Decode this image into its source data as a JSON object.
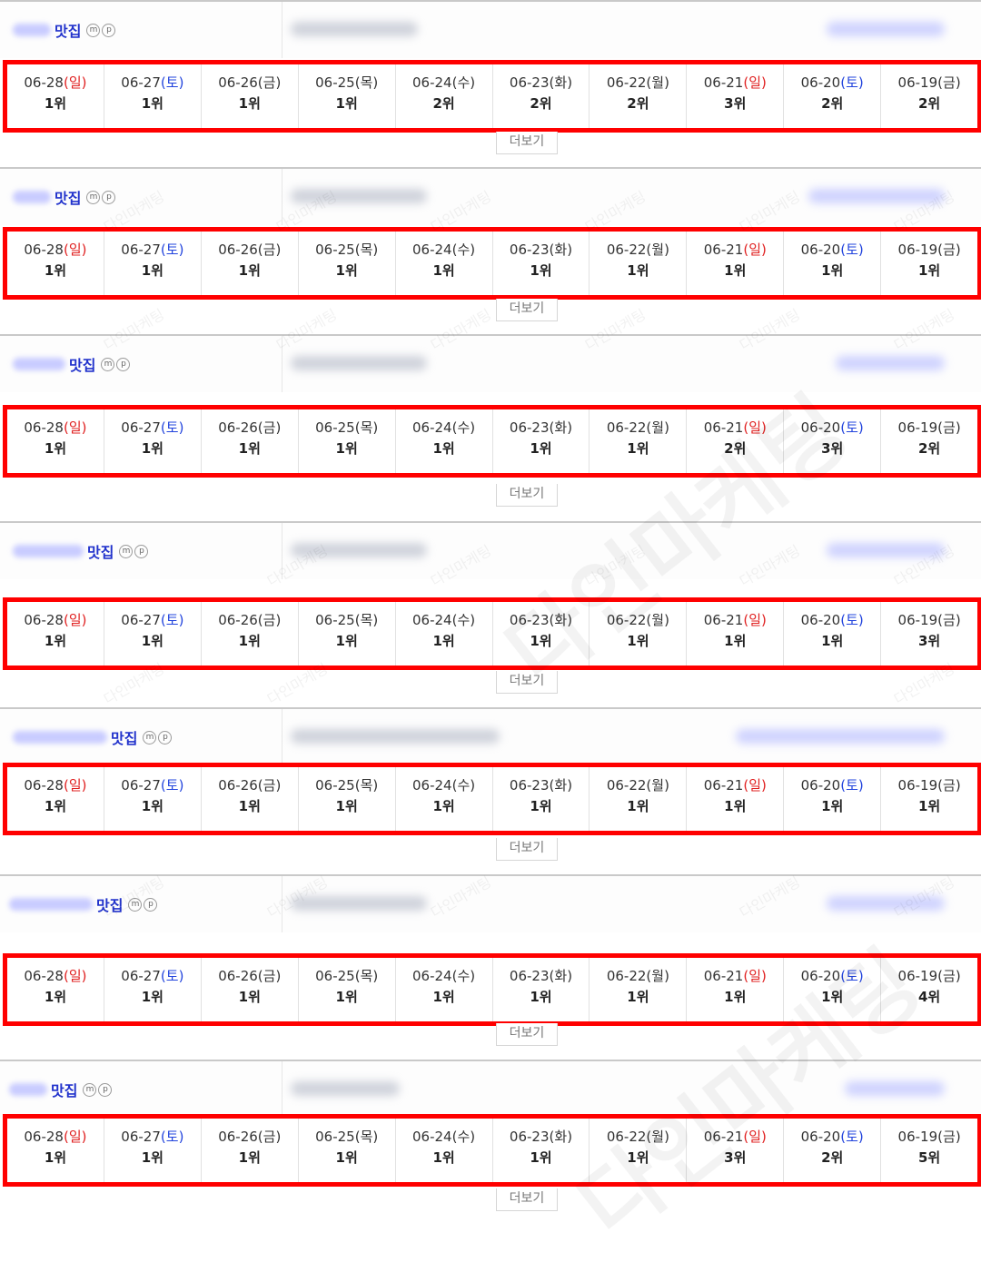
{
  "keyword": "맛집",
  "icons": [
    "m-circle-icon",
    "p-circle-icon"
  ],
  "icon_letters": {
    "m": "m",
    "p": "p"
  },
  "more_label": "더보기",
  "watermark": "다인마케팅",
  "colors": {
    "highlight": "#ff0000",
    "sunday": "#e02020",
    "saturday": "#2244dd",
    "keyword": "#2233cc"
  },
  "dates": [
    {
      "date": "06-28",
      "day": "일"
    },
    {
      "date": "06-27",
      "day": "토"
    },
    {
      "date": "06-26",
      "day": "금"
    },
    {
      "date": "06-25",
      "day": "목"
    },
    {
      "date": "06-24",
      "day": "수"
    },
    {
      "date": "06-23",
      "day": "화"
    },
    {
      "date": "06-22",
      "day": "월"
    },
    {
      "date": "06-21",
      "day": "일"
    },
    {
      "date": "06-20",
      "day": "토"
    },
    {
      "date": "06-19",
      "day": "금"
    }
  ],
  "rows": [
    {
      "keyword": "맛집",
      "ranks": [
        "1위",
        "1위",
        "1위",
        "1위",
        "2위",
        "2위",
        "2위",
        "3위",
        "2위",
        "2위"
      ]
    },
    {
      "keyword": "맛집",
      "ranks": [
        "1위",
        "1위",
        "1위",
        "1위",
        "1위",
        "1위",
        "1위",
        "1위",
        "1위",
        "1위"
      ]
    },
    {
      "keyword": "맛집",
      "ranks": [
        "1위",
        "1위",
        "1위",
        "1위",
        "1위",
        "1위",
        "1위",
        "2위",
        "3위",
        "2위"
      ]
    },
    {
      "keyword": "맛집",
      "ranks": [
        "1위",
        "1위",
        "1위",
        "1위",
        "1위",
        "1위",
        "1위",
        "1위",
        "1위",
        "3위"
      ]
    },
    {
      "keyword": "맛집",
      "ranks": [
        "1위",
        "1위",
        "1위",
        "1위",
        "1위",
        "1위",
        "1위",
        "1위",
        "1위",
        "1위"
      ]
    },
    {
      "keyword": "맛집",
      "ranks": [
        "1위",
        "1위",
        "1위",
        "1위",
        "1위",
        "1위",
        "1위",
        "1위",
        "1위",
        "4위"
      ]
    },
    {
      "keyword": "맛집",
      "ranks": [
        "1위",
        "1위",
        "1위",
        "1위",
        "1위",
        "1위",
        "1위",
        "3위",
        "2위",
        "5위"
      ]
    }
  ]
}
